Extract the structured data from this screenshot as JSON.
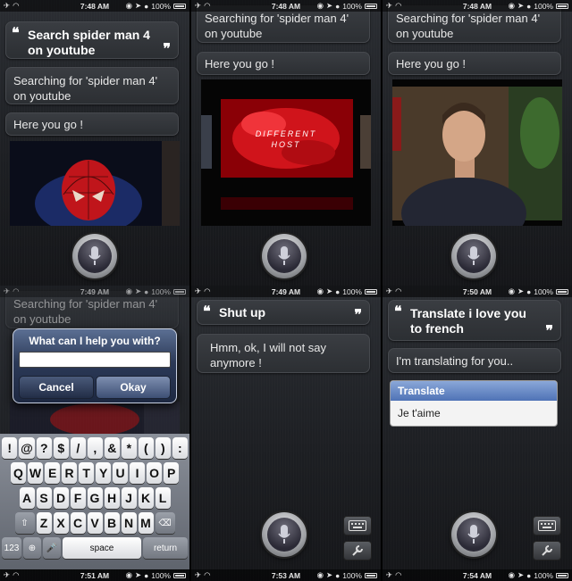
{
  "status": {
    "p1": {
      "time": "7:48 AM",
      "battery": "100%"
    },
    "p2": {
      "time": "7:48 AM",
      "battery": "100%"
    },
    "p3": {
      "time": "7:48 AM",
      "battery": "100%"
    },
    "p4": {
      "time": "7:49 AM",
      "battery": "100%"
    },
    "p5": {
      "time": "7:49 AM",
      "battery": "100%"
    },
    "p6": {
      "time": "7:50 AM",
      "battery": "100%"
    },
    "p4_bottom": {
      "time": "7:51 AM",
      "battery": "100%"
    },
    "p5_bottom": {
      "time": "7:53 AM",
      "battery": "100%"
    },
    "p6_bottom": {
      "time": "7:54 AM",
      "battery": "100%"
    }
  },
  "panel1": {
    "user_query": "Search spider man 4 on youtube",
    "reply1": "Searching for 'spider man 4' on youtube",
    "reply2": "Here you go !"
  },
  "panel2": {
    "reply1": "Searching for 'spider man 4' on youtube",
    "reply2": "Here you go !",
    "video_text": "DIFFERENT HOST"
  },
  "panel3": {
    "reply1": "Searching for 'spider man 4' on youtube",
    "reply2": "Here you go !"
  },
  "panel4": {
    "bg_reply": "Searching for 'spider man 4' on youtube",
    "dialog_title": "What can I help you with?",
    "cancel_label": "Cancel",
    "okay_label": "Okay",
    "keyboard": {
      "row1": [
        "!",
        "@",
        "?",
        "$",
        "/",
        ",",
        "&",
        "*",
        "(",
        ")",
        ":"
      ],
      "row2": [
        "Q",
        "W",
        "E",
        "R",
        "T",
        "Y",
        "U",
        "I",
        "O",
        "P"
      ],
      "row3": [
        "A",
        "S",
        "D",
        "F",
        "G",
        "H",
        "J",
        "K",
        "L"
      ],
      "row4": [
        "Z",
        "X",
        "C",
        "V",
        "B",
        "N",
        "M"
      ],
      "num_label": "123",
      "space_label": "space",
      "return_label": "return"
    }
  },
  "panel5": {
    "user_query": "Shut up",
    "reply1": "Hmm, ok, I will not say anymore !"
  },
  "panel6": {
    "user_query": "Translate i love you to french",
    "reply1": "I'm translating for you..",
    "translate_header": "Translate",
    "translate_value": "Je t'aime"
  },
  "colors": {
    "accent": "#4f73b6",
    "bubble": "#34373c",
    "bg": "#1d1f23"
  }
}
